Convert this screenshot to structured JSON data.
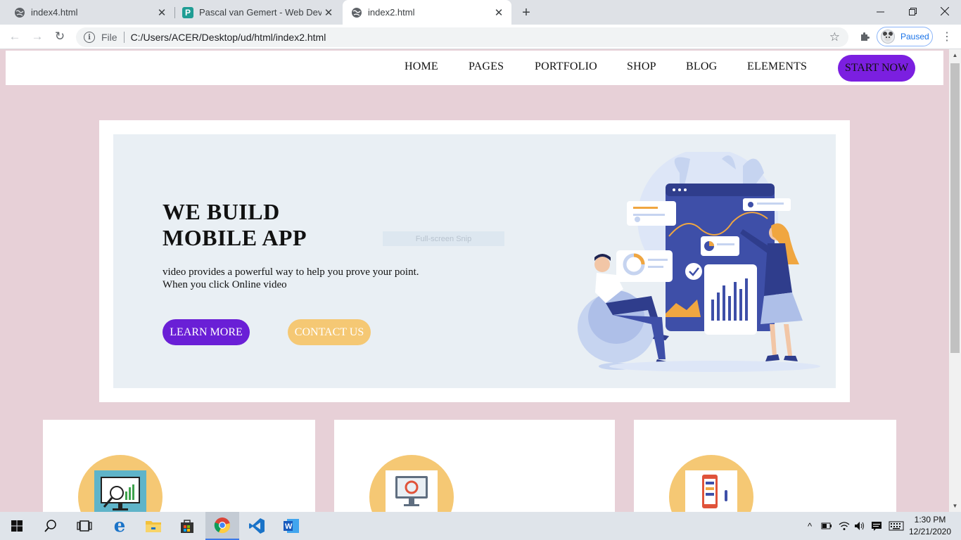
{
  "browser": {
    "tabs": [
      {
        "title": "index4.html",
        "active": false
      },
      {
        "title": "Pascal van Gemert - Web Develop",
        "active": false
      },
      {
        "title": "index2.html",
        "active": true
      }
    ],
    "address": {
      "scheme": "File",
      "url": "C:/Users/ACER/Desktop/ud/html/index2.html"
    },
    "profile_status": "Paused"
  },
  "site": {
    "nav": {
      "links": [
        "HOME",
        "PAGES",
        "PORTFOLIO",
        "SHOP",
        "BLOG",
        "ELEMENTS"
      ],
      "cta": "START NOW"
    },
    "hero": {
      "title_line1": "WE BUILD",
      "title_line2": "MOBILE APP",
      "text_line1": "video provides a powerful way to help you prove your point.",
      "text_line2": "When you click Online video",
      "learn_more": "LEARN MORE",
      "contact_us": "CONTACT US",
      "snip_overlay": "Full-screen Snip"
    }
  },
  "colors": {
    "page_bg": "#e7d0d7",
    "primary_purple": "#7b1fe0",
    "accent_orange": "#f5c874",
    "hero_bg": "#e9eff4"
  },
  "taskbar": {
    "time": "1:30 PM",
    "date": "12/21/2020"
  }
}
